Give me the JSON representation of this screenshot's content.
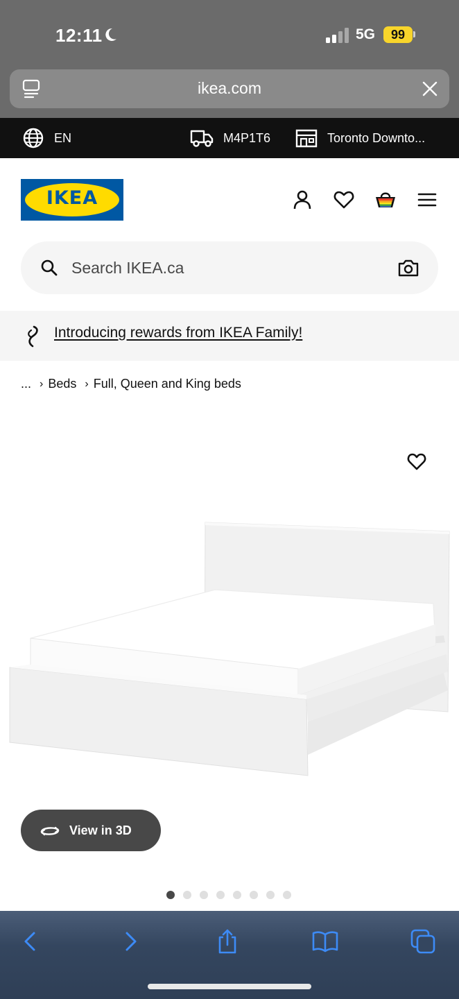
{
  "status_bar": {
    "time": "12:11",
    "network": "5G",
    "battery": "99"
  },
  "browser": {
    "url": "ikea.com"
  },
  "utility_bar": {
    "language": "EN",
    "postal_code": "M4P1T6",
    "store": "Toronto Downto..."
  },
  "search": {
    "placeholder": "Search IKEA.ca"
  },
  "promo": {
    "text": "Introducing rewards from IKEA Family!"
  },
  "breadcrumb": {
    "ellipsis": "...",
    "items": [
      "Beds",
      "Full, Queen and King beds"
    ]
  },
  "logo": {
    "text": "IKEA"
  },
  "product": {
    "view_3d_label": "View in 3D",
    "image_count": 8,
    "active_image_index": 1
  },
  "colors": {
    "ikea_blue": "#0058a3",
    "ikea_yellow": "#ffdb00",
    "safari_accent": "#3d8bf6"
  }
}
